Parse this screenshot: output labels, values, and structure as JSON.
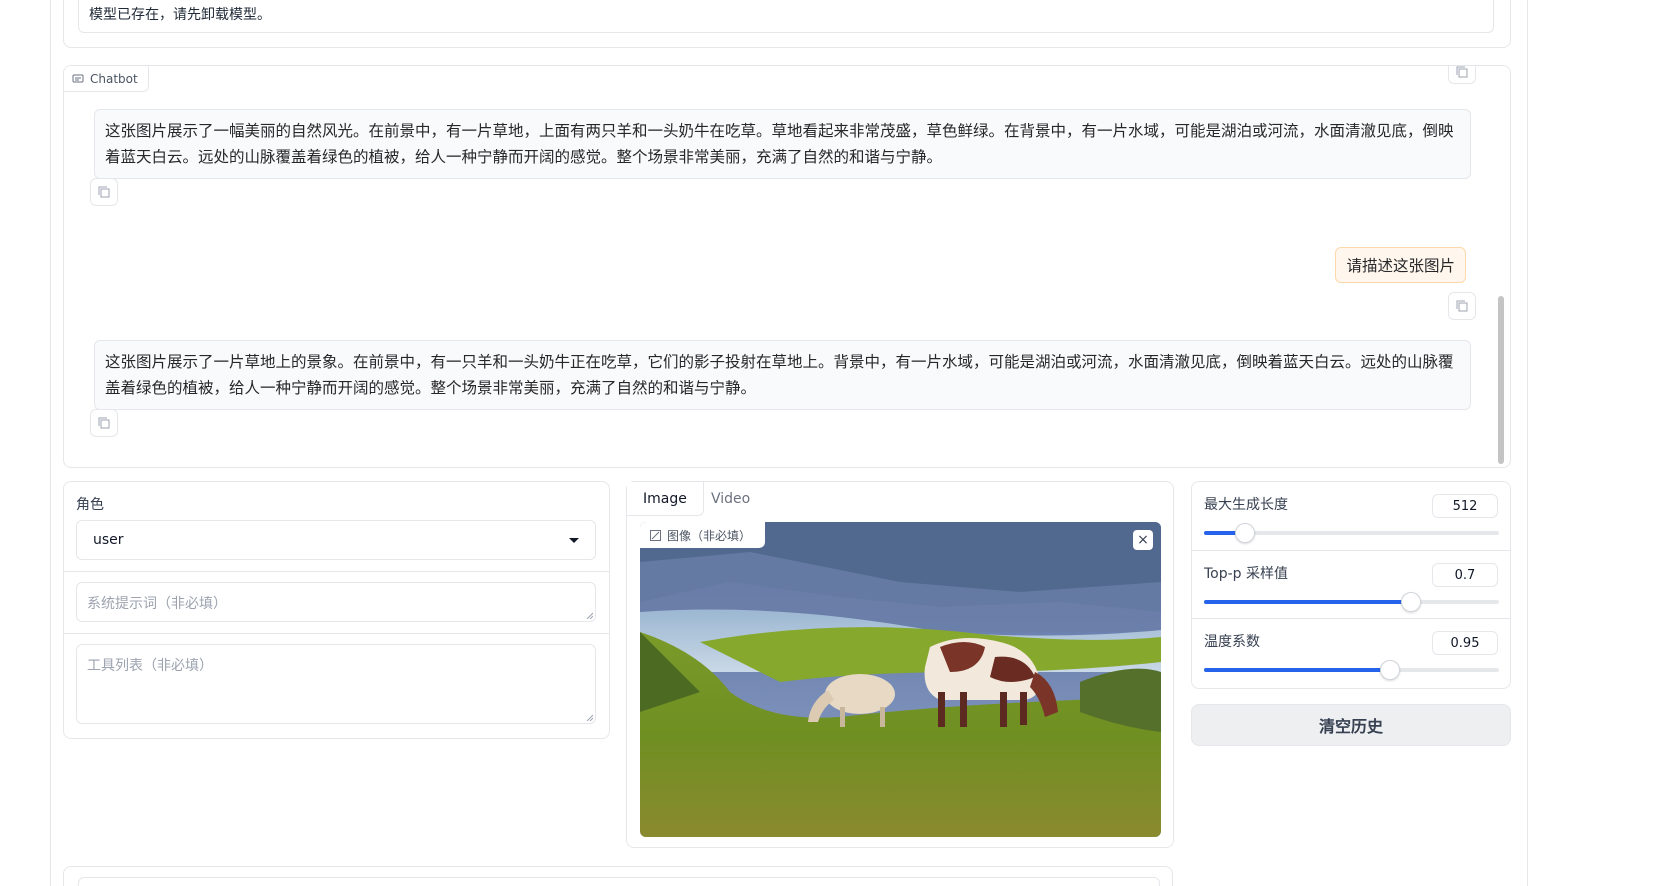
{
  "status": {
    "text": "模型已存在，请先卸载模型。"
  },
  "chatbot": {
    "label": "Chatbot",
    "messages": [
      {
        "role": "assistant",
        "text": "这张图片展示了一幅美丽的自然风光。在前景中，有一片草地，上面有两只羊和一头奶牛在吃草。草地看起来非常茂盛，草色鲜绿。在背景中，有一片水域，可能是湖泊或河流，水面清澈见底，倒映着蓝天白云。远处的山脉覆盖着绿色的植被，给人一种宁静而开阔的感觉。整个场景非常美丽，充满了自然的和谐与宁静。"
      },
      {
        "role": "user",
        "text": "请描述这张图片"
      },
      {
        "role": "assistant",
        "text": "这张图片展示了一片草地上的景象。在前景中，有一只羊和一头奶牛正在吃草，它们的影子投射在草地上。背景中，有一片水域，可能是湖泊或河流，水面清澈见底，倒映着蓝天白云。远处的山脉覆盖着绿色的植被，给人一种宁静而开阔的感觉。整个场景非常美丽，充满了自然的和谐与宁静。"
      }
    ]
  },
  "controls": {
    "role_label": "角色",
    "role_value": "user",
    "system_placeholder": "系统提示词（非必填）",
    "tools_placeholder": "工具列表（非必填）"
  },
  "media": {
    "tabs": [
      "Image",
      "Video"
    ],
    "active_tab": "Image",
    "image_label": "图像（非必填）",
    "close_glyph": "×"
  },
  "sliders": [
    {
      "label": "最大生成长度",
      "value": "512",
      "fraction": 0.14
    },
    {
      "label": "Top-p 采样值",
      "value": "0.7",
      "fraction": 0.7
    },
    {
      "label": "温度系数",
      "value": "0.95",
      "fraction": 0.63
    }
  ],
  "buttons": {
    "clear_history": "清空历史"
  },
  "colors": {
    "accent": "#2563eb",
    "user_bubble": "#fff7ed",
    "bot_bubble": "#f9fafb"
  }
}
